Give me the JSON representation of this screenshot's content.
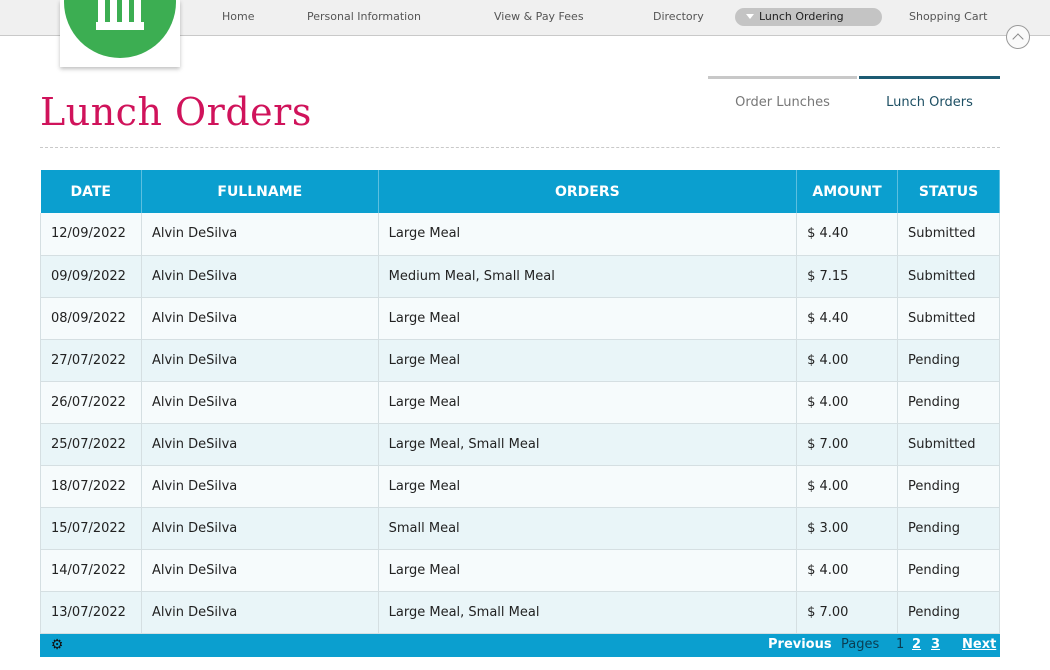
{
  "nav": {
    "home": "Home",
    "personal": "Personal Information",
    "fees": "View & Pay Fees",
    "directory": "Directory",
    "lunch": "Lunch Ordering",
    "cart": "Shopping Cart"
  },
  "page": {
    "title": "Lunch Orders"
  },
  "tabs": {
    "order_lunches": "Order Lunches",
    "lunch_orders": "Lunch Orders"
  },
  "table": {
    "headers": [
      "DATE",
      "FULLNAME",
      "ORDERS",
      "AMOUNT",
      "STATUS"
    ],
    "rows": [
      {
        "date": "12/09/2022",
        "name": "Alvin DeSilva",
        "orders": "Large Meal",
        "amount": "$ 4.40",
        "status": "Submitted"
      },
      {
        "date": "09/09/2022",
        "name": "Alvin DeSilva",
        "orders": "Medium Meal, Small Meal",
        "amount": "$ 7.15",
        "status": "Submitted"
      },
      {
        "date": "08/09/2022",
        "name": "Alvin DeSilva",
        "orders": "Large Meal",
        "amount": "$ 4.40",
        "status": "Submitted"
      },
      {
        "date": "27/07/2022",
        "name": "Alvin DeSilva",
        "orders": "Large Meal",
        "amount": "$ 4.00",
        "status": "Pending"
      },
      {
        "date": "26/07/2022",
        "name": "Alvin DeSilva",
        "orders": "Large Meal",
        "amount": "$ 4.00",
        "status": "Pending"
      },
      {
        "date": "25/07/2022",
        "name": "Alvin DeSilva",
        "orders": "Large Meal, Small Meal",
        "amount": "$ 7.00",
        "status": "Submitted"
      },
      {
        "date": "18/07/2022",
        "name": "Alvin DeSilva",
        "orders": "Large Meal",
        "amount": "$ 4.00",
        "status": "Pending"
      },
      {
        "date": "15/07/2022",
        "name": "Alvin DeSilva",
        "orders": "Small Meal",
        "amount": "$ 3.00",
        "status": "Pending"
      },
      {
        "date": "14/07/2022",
        "name": "Alvin DeSilva",
        "orders": "Large Meal",
        "amount": "$ 4.00",
        "status": "Pending"
      },
      {
        "date": "13/07/2022",
        "name": "Alvin DeSilva",
        "orders": "Large Meal, Small Meal",
        "amount": "$ 7.00",
        "status": "Pending"
      }
    ]
  },
  "pager": {
    "previous": "Previous",
    "pages_label": "Pages",
    "pages": [
      "1",
      "2",
      "3"
    ],
    "next": "Next"
  },
  "icons": {
    "settings": "gear-icon",
    "scroll_top": "chevron-up-icon",
    "logo": "school-building-icon"
  },
  "colors": {
    "accent": "#0b9fcf",
    "title": "#d0135b",
    "logo": "#3cae52"
  }
}
